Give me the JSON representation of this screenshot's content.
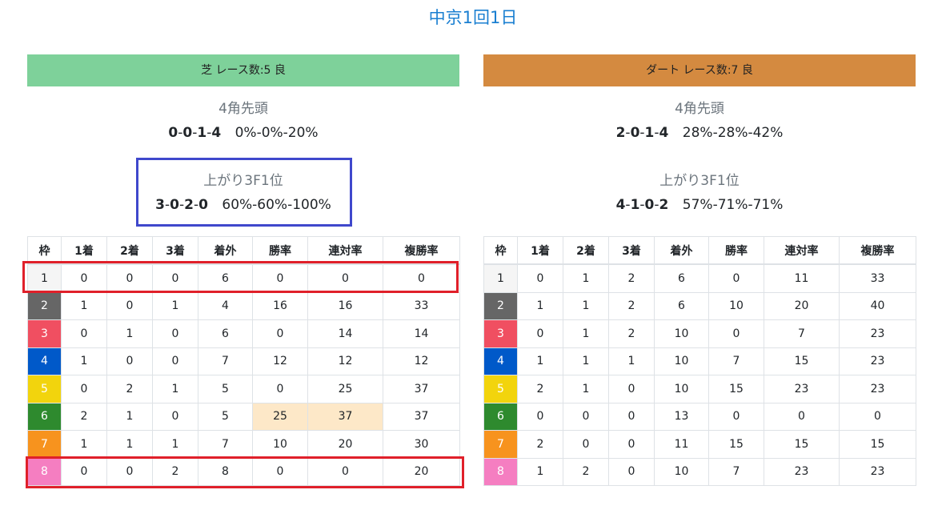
{
  "page_title": "中京1回1日",
  "colors": {
    "title": "#1a7fd1",
    "turf_header": "#7ed19a",
    "dirt_header": "#d48a40",
    "highlight_cell": "#fde8c8",
    "annotation_blue": "#3f48cc",
    "annotation_red": "#e0202a"
  },
  "column_headers": [
    "枠",
    "1着",
    "2着",
    "3着",
    "着外",
    "勝率",
    "連対率",
    "複勝率"
  ],
  "waku_colors": [
    "#f5f5f5",
    "#666666",
    "#f04f61",
    "#0059c9",
    "#f2d40d",
    "#2e8a2e",
    "#f7931e",
    "#f57ec1"
  ],
  "waku_text_colors": [
    "#212529",
    "#ffffff",
    "#ffffff",
    "#ffffff",
    "#ffffff",
    "#ffffff",
    "#ffffff",
    "#ffffff"
  ],
  "turf": {
    "header": "芝 レース数:5  良",
    "corner4_title": "4角先頭",
    "corner4_record": [
      "0",
      "0",
      "1",
      "4"
    ],
    "corner4_rates": "0%-0%-20%",
    "last3f_title": "上がり3F1位",
    "last3f_record": [
      "3",
      "0",
      "2",
      "0"
    ],
    "last3f_rates": "60%-60%-100%",
    "rows": [
      [
        "1",
        "0",
        "0",
        "0",
        "6",
        "0",
        "0",
        "0"
      ],
      [
        "2",
        "1",
        "0",
        "1",
        "4",
        "16",
        "16",
        "33"
      ],
      [
        "3",
        "0",
        "1",
        "0",
        "6",
        "0",
        "14",
        "14"
      ],
      [
        "4",
        "1",
        "0",
        "0",
        "7",
        "12",
        "12",
        "12"
      ],
      [
        "5",
        "0",
        "2",
        "1",
        "5",
        "0",
        "25",
        "37"
      ],
      [
        "6",
        "2",
        "1",
        "0",
        "5",
        "25",
        "37",
        "37"
      ],
      [
        "7",
        "1",
        "1",
        "1",
        "7",
        "10",
        "20",
        "30"
      ],
      [
        "8",
        "0",
        "0",
        "2",
        "8",
        "0",
        "0",
        "20"
      ]
    ]
  },
  "dirt": {
    "header": "ダート レース数:7  良",
    "corner4_title": "4角先頭",
    "corner4_record": [
      "2",
      "0",
      "1",
      "4"
    ],
    "corner4_rates": "28%-28%-42%",
    "last3f_title": "上がり3F1位",
    "last3f_record": [
      "4",
      "1",
      "0",
      "2"
    ],
    "last3f_rates": "57%-71%-71%",
    "rows": [
      [
        "1",
        "0",
        "1",
        "2",
        "6",
        "0",
        "11",
        "33"
      ],
      [
        "2",
        "1",
        "1",
        "2",
        "6",
        "10",
        "20",
        "40"
      ],
      [
        "3",
        "0",
        "1",
        "2",
        "10",
        "0",
        "7",
        "23"
      ],
      [
        "4",
        "1",
        "1",
        "1",
        "10",
        "7",
        "15",
        "23"
      ],
      [
        "5",
        "2",
        "1",
        "0",
        "10",
        "15",
        "23",
        "23"
      ],
      [
        "6",
        "0",
        "0",
        "0",
        "13",
        "0",
        "0",
        "0"
      ],
      [
        "7",
        "2",
        "0",
        "0",
        "11",
        "15",
        "15",
        "15"
      ],
      [
        "8",
        "1",
        "2",
        "0",
        "10",
        "7",
        "23",
        "23"
      ]
    ]
  }
}
